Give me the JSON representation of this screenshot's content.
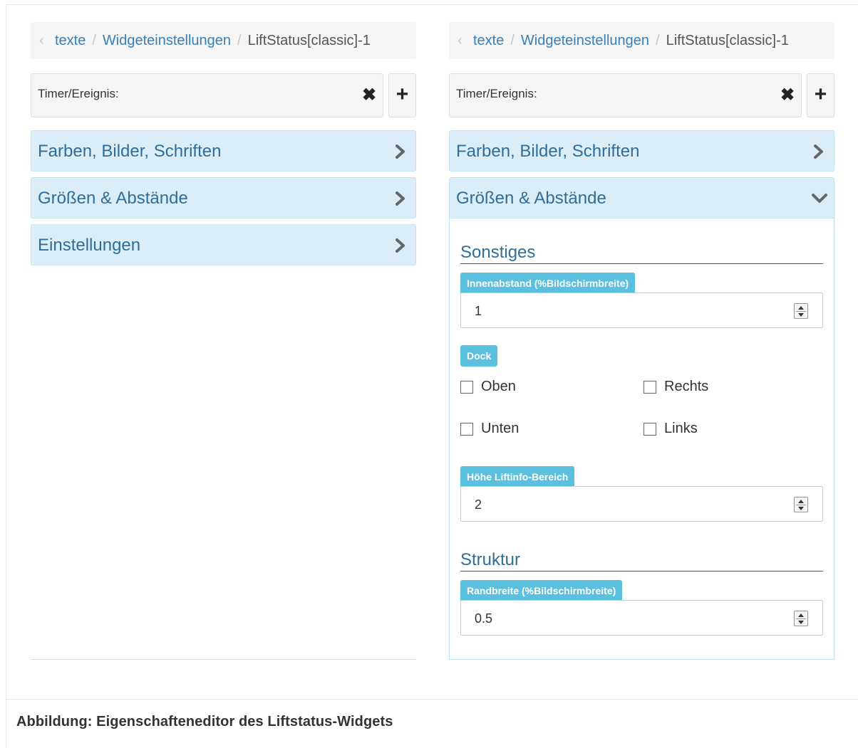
{
  "breadcrumb": {
    "items": [
      "texte",
      "Widgeteinstellungen"
    ],
    "current": "LiftStatus[classic]-1",
    "separator": "/"
  },
  "timer": {
    "label": "Timer/Ereignis:",
    "clear_icon": "✖",
    "add_icon": "+"
  },
  "accordion": {
    "items": [
      {
        "title": "Farben, Bilder, Schriften"
      },
      {
        "title": "Größen & Abstände"
      },
      {
        "title": "Einstellungen"
      }
    ]
  },
  "groessen": {
    "sections": [
      {
        "title": "Sonstiges"
      },
      {
        "title": "Struktur"
      }
    ],
    "innenabstand": {
      "label": "Innenabstand (%Bildschirmbreite)",
      "value": "1"
    },
    "dock": {
      "label": "Dock",
      "options": [
        {
          "label": "Oben",
          "checked": false
        },
        {
          "label": "Rechts",
          "checked": false
        },
        {
          "label": "Unten",
          "checked": false
        },
        {
          "label": "Links",
          "checked": false
        }
      ]
    },
    "hoehe": {
      "label": "Höhe Liftinfo-Bereich",
      "value": "2"
    },
    "randbreite": {
      "label": "Randbreite (%Bildschirmbreite)",
      "value": "0.5"
    }
  },
  "caption": "Abbildung: Eigenschafteneditor des Liftstatus-Widgets",
  "colors": {
    "accordion_bg": "#dbeef7",
    "accordion_text": "#2f6d9b",
    "badge_bg": "#5bc0de",
    "link": "#3a7fb6"
  }
}
